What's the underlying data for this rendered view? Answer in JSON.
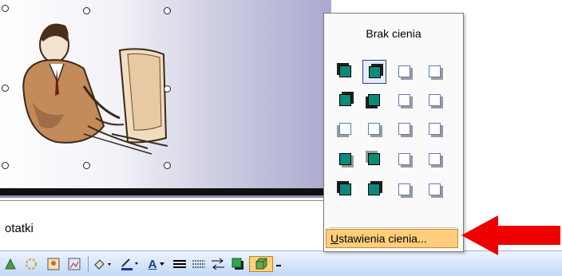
{
  "notes": {
    "label": "otatki"
  },
  "shadow_menu": {
    "header": "Brak cienia",
    "footer_label_u": "U",
    "footer_label_rest": "stawienia cienia...",
    "selected_index": 1,
    "accent_color": "#0b8a7a"
  },
  "toolbar": {
    "items": [
      "insert-diagram-icon",
      "insert-clipart-icon",
      "insert-picture-icon",
      "insert-image-icon",
      "fill-color-icon",
      "line-color-icon",
      "font-color-icon",
      "line-style-icon",
      "dash-style-icon",
      "arrow-style-icon",
      "shadow-style-icon",
      "3d-style-icon"
    ],
    "font_color_glyph": "A"
  },
  "annotation": {
    "arrow_color": "#ee0000"
  }
}
